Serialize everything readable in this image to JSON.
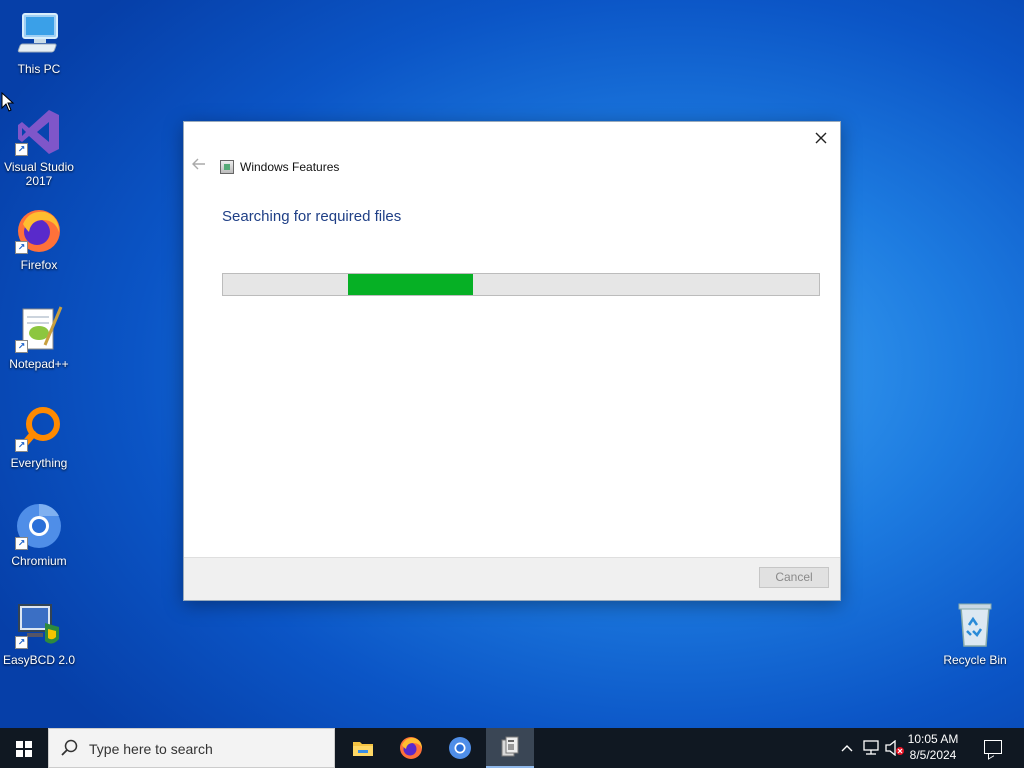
{
  "desktop": {
    "icons": [
      {
        "label": "This PC",
        "icon": "this-pc-icon"
      },
      {
        "label": "Visual Studio 2017",
        "icon": "visual-studio-icon"
      },
      {
        "label": "Firefox",
        "icon": "firefox-icon"
      },
      {
        "label": "Notepad++",
        "icon": "notepadpp-icon"
      },
      {
        "label": "Everything",
        "icon": "everything-icon"
      },
      {
        "label": "Chromium",
        "icon": "chromium-icon"
      },
      {
        "label": "EasyBCD 2.0",
        "icon": "easybcd-icon"
      },
      {
        "label": "Recycle Bin",
        "icon": "recycle-bin-icon"
      }
    ]
  },
  "dialog": {
    "title": "Windows Features",
    "heading": "Searching for required files",
    "progress": {
      "start_fraction": 0.21,
      "end_fraction": 0.42,
      "color": "#06b025"
    },
    "cancel_label": "Cancel"
  },
  "taskbar": {
    "search_placeholder": "Type here to search",
    "pinned": [
      "file-explorer-icon",
      "firefox-icon",
      "chromium-icon",
      "windows-features-icon"
    ],
    "active": "windows-features-icon",
    "time": "10:05 AM",
    "date": "8/5/2024"
  }
}
